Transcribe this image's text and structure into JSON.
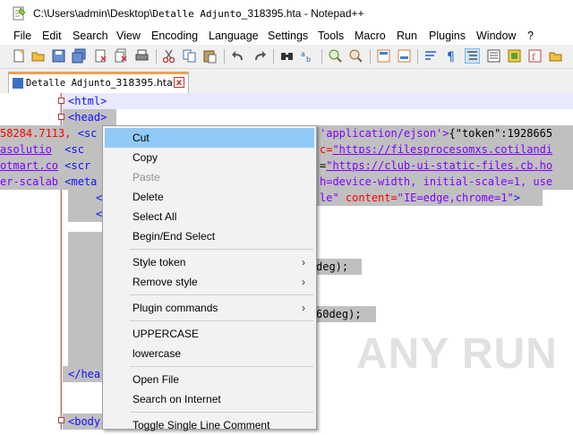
{
  "window": {
    "title_prefix": "C:\\Users\\admin\\Desktop\\",
    "title_file": "Detalle Adjunto",
    "title_suffix": "_318395.hta - Notepad++"
  },
  "menu": [
    "File",
    "Edit",
    "Search",
    "View",
    "Encoding",
    "Language",
    "Settings",
    "Tools",
    "Macro",
    "Run",
    "Plugins",
    "Window",
    "?"
  ],
  "tab": {
    "label_mono": "Detalle Adjunto",
    "label_rest": "_318395.hta",
    "close": "x"
  },
  "code": {
    "line1": "<html>",
    "line2": "<head>",
    "line3_a": "58284.7113,",
    "line3_b": "<sc",
    "line3_c": "'application/ejson'>",
    "line3_d": "{\"token\":1928665",
    "line4_a": "asolutio",
    "line4_b": "<sc",
    "line4_c": "c=",
    "line4_d": "\"https://filesprocesomxs.cotilandi",
    "line5_a": "otmart.co",
    "line5_b": "<scr",
    "line5_c": "=",
    "line5_d": "\"https://club-ui-static-files.cb.ho",
    "line6_a": "er-scalab",
    "line6_b": "<meta",
    "line6_c": "h=device-width, initial-scale=1, use",
    "line7_a": "<",
    "line7_b": "le\"",
    "line7_c": "content=",
    "line7_d": "\"IE=edge,chrome=1\"",
    "line7_e": ">",
    "line8": "<",
    "line11": "deg);",
    "line14": "60deg);",
    "line_head_close": "</hea",
    "line_body": "<body"
  },
  "context_menu": [
    {
      "label": "Cut",
      "state": "highlighted"
    },
    {
      "label": "Copy",
      "state": "normal"
    },
    {
      "label": "Paste",
      "state": "disabled"
    },
    {
      "label": "Delete",
      "state": "normal"
    },
    {
      "label": "Select All",
      "state": "normal"
    },
    {
      "label": "Begin/End Select",
      "state": "normal"
    },
    {
      "label": "Style token",
      "state": "submenu"
    },
    {
      "label": "Remove style",
      "state": "submenu"
    },
    {
      "label": "Plugin commands",
      "state": "submenu"
    },
    {
      "label": "UPPERCASE",
      "state": "normal"
    },
    {
      "label": "lowercase",
      "state": "normal"
    },
    {
      "label": "Open File",
      "state": "normal"
    },
    {
      "label": "Search on Internet",
      "state": "normal"
    },
    {
      "label": "Toggle Single Line Comment",
      "state": "normal"
    }
  ],
  "submenu_arrow": "›",
  "watermark": "ANY RUN",
  "colors": {
    "menu_highlight": "#91c9f7",
    "selection": "#c0c0c0",
    "tag": "#1010ff",
    "attribute": "#ff0000",
    "string": "#8000ff"
  }
}
